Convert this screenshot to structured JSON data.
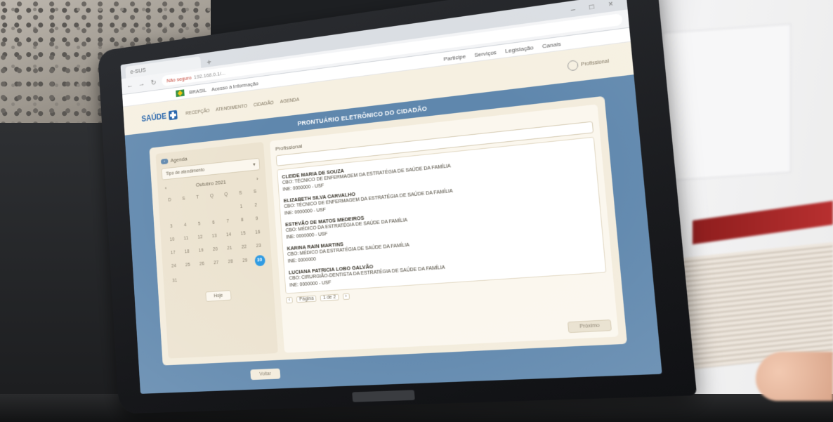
{
  "browser": {
    "tab_title": "e-SUS",
    "window_controls": "– □ ×",
    "url_warning": "Não seguro",
    "url_text": "192.168.0.1/..."
  },
  "govbar": {
    "country": "BRASIL",
    "access": "Acesso à Informação",
    "links": [
      "Participe",
      "Serviços",
      "Legislação",
      "Canais"
    ]
  },
  "header": {
    "logo": "SAÚDE",
    "nav": [
      "RECEPÇÃO",
      "ATENDIMENTO",
      "CIDADÃO",
      "AGENDA"
    ],
    "user_label": "Profissional"
  },
  "app": {
    "title": "PRONTUÁRIO ELETRÔNICO DO CIDADÃO",
    "agenda": {
      "back_label": "‹",
      "heading": "Agenda",
      "select_value": "Tipo de atendimento",
      "month": "Outubro 2021",
      "prev": "‹",
      "next": "›",
      "weekdays": [
        "D",
        "S",
        "T",
        "Q",
        "Q",
        "S",
        "S"
      ],
      "days": [
        "",
        "",
        "",
        "",
        "",
        "1",
        "2",
        "3",
        "4",
        "5",
        "6",
        "7",
        "8",
        "9",
        "10",
        "11",
        "12",
        "13",
        "14",
        "15",
        "16",
        "17",
        "18",
        "19",
        "20",
        "21",
        "22",
        "23",
        "24",
        "25",
        "26",
        "27",
        "28",
        "29",
        "30",
        "31"
      ],
      "selected_day": "30",
      "today_button": "Hoje"
    },
    "professionals": {
      "label": "Profissional",
      "items": [
        {
          "name": "CLEIDE MARIA DE SOUZA",
          "cbo": "CBO: TÉCNICO DE ENFERMAGEM DA ESTRATÉGIA DE SAÚDE DA FAMÍLIA",
          "ine": "INE: 0000000 - USF"
        },
        {
          "name": "ELIZABETH SILVA CARVALHO",
          "cbo": "CBO: TÉCNICO DE ENFERMAGEM DA ESTRATÉGIA DE SAÚDE DA FAMÍLIA",
          "ine": "INE: 0000000 - USF"
        },
        {
          "name": "ESTEVÃO DE MATOS MEDEIROS",
          "cbo": "CBO: MÉDICO DA ESTRATÉGIA DE SAÚDE DA FAMÍLIA",
          "ine": "INE: 0000000 - USF"
        },
        {
          "name": "KARINA RAIN MARTINS",
          "cbo": "CBO: MÉDICO DA ESTRATÉGIA DE SAÚDE DA FAMÍLIA",
          "ine": "INE: 0000000"
        },
        {
          "name": "LUCIANA PATRICIA LOBO GALVÃO",
          "cbo": "CBO: CIRURGIÃO-DENTISTA DA ESTRATÉGIA DE SAÚDE DA FAMÍLIA",
          "ine": "INE: 0000000 - USF"
        }
      ],
      "pager": [
        "‹",
        "Página",
        "1 de 2",
        "›"
      ],
      "next_button": "Próximo"
    },
    "footer_button": "Voltar"
  }
}
